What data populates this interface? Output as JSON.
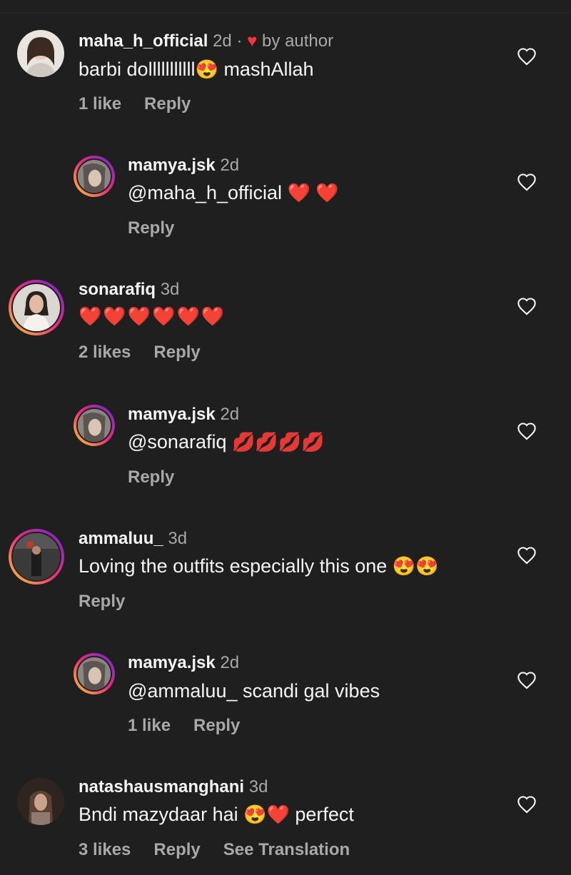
{
  "comments": [
    {
      "username": "maha_h_official",
      "time": "2d",
      "separator": "·",
      "liked_by_author_heart": "♥",
      "liked_by_author_label": "by author",
      "text": "barbi dolllllllllll",
      "emoji": "😍",
      "text_after": " mashAllah",
      "likes": "1 like",
      "reply_label": "Reply"
    },
    {
      "username": "mamya.jsk",
      "time": "2d",
      "text": "@maha_h_official ",
      "emoji": "❤️ ❤️",
      "reply_label": "Reply"
    },
    {
      "username": "sonarafiq",
      "time": "3d",
      "text": "",
      "emoji": "❤️❤️❤️❤️❤️❤️",
      "likes": "2 likes",
      "reply_label": "Reply"
    },
    {
      "username": "mamya.jsk",
      "time": "2d",
      "text": "@sonarafiq ",
      "emoji": "💋💋💋💋",
      "reply_label": "Reply"
    },
    {
      "username": "ammaluu_",
      "time": "3d",
      "text": "Loving the outfits especially this one ",
      "emoji": "😍😍",
      "reply_label": "Reply"
    },
    {
      "username": "mamya.jsk",
      "time": "2d",
      "text": "@ammaluu_ scandi gal vibes",
      "likes": "1 like",
      "reply_label": "Reply"
    },
    {
      "username": "natashausmanghani",
      "time": "3d",
      "text": "Bndi mazydaar hai ",
      "emoji": "😍❤️",
      "text_after": " perfect",
      "likes": "3 likes",
      "reply_label": "Reply",
      "translate_label": "See Translation"
    }
  ],
  "colors": {
    "background": "#1f1f1f",
    "primary_text": "#f5f5f5",
    "secondary_text": "#a8a8a8",
    "author_heart": "#ff3040"
  },
  "icons": {
    "like": "heart-outline-icon",
    "author_like": "heart-filled-icon"
  }
}
